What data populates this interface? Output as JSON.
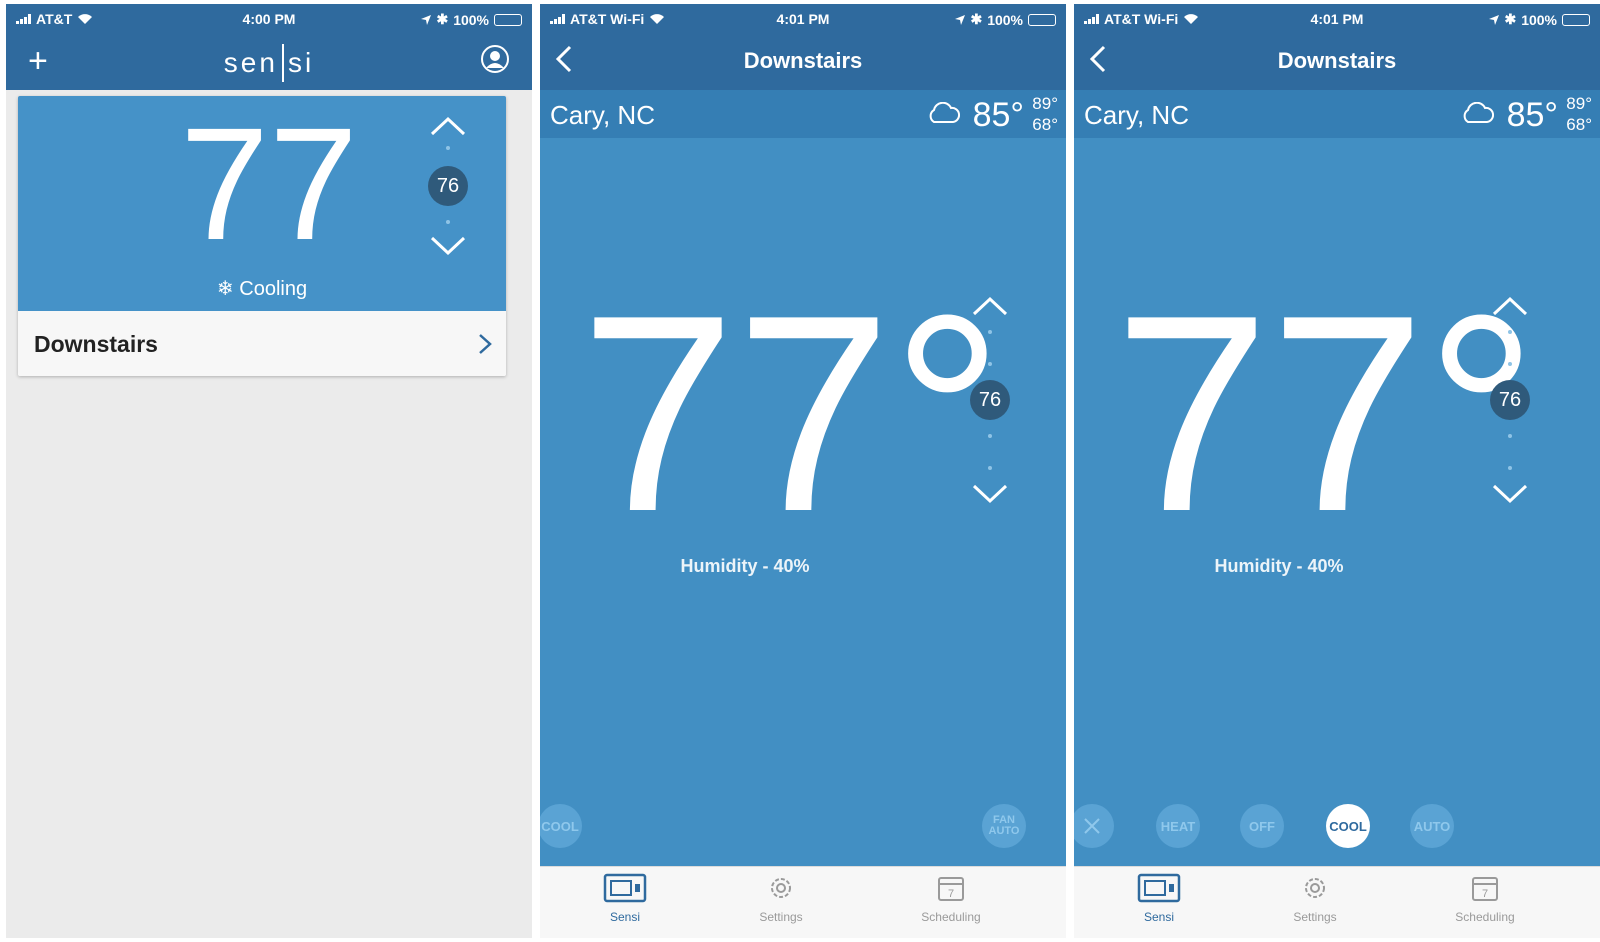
{
  "screens": [
    {
      "status": {
        "carrier": "AT&T",
        "time": "4:00 PM",
        "battery": "100%"
      },
      "header": {
        "logo_left": "sen",
        "logo_right": "si"
      },
      "card": {
        "current_temp": "77",
        "setpoint": "76",
        "mode_status": "Cooling",
        "thermostat_name": "Downstairs"
      }
    },
    {
      "status": {
        "carrier": "AT&T Wi-Fi",
        "time": "4:01 PM",
        "battery": "100%"
      },
      "header": {
        "title": "Downstairs"
      },
      "weather": {
        "city": "Cary, NC",
        "temp": "85°",
        "high": "89°",
        "low": "68°"
      },
      "current_temp": "77°",
      "setpoint": "76",
      "humidity": "Humidity - 40%",
      "mode_left": "COOL",
      "fan_line1": "FAN",
      "fan_line2": "AUTO",
      "tabs": [
        "Sensi",
        "Settings",
        "Scheduling"
      ],
      "calendar_day": "7"
    },
    {
      "status": {
        "carrier": "AT&T Wi-Fi",
        "time": "4:01 PM",
        "battery": "100%"
      },
      "header": {
        "title": "Downstairs"
      },
      "weather": {
        "city": "Cary, NC",
        "temp": "85°",
        "high": "89°",
        "low": "68°"
      },
      "current_temp": "77°",
      "setpoint": "76",
      "humidity": "Humidity - 40%",
      "modes": [
        "HEAT",
        "OFF",
        "COOL",
        "AUTO"
      ],
      "selected_mode": "COOL",
      "tabs": [
        "Sensi",
        "Settings",
        "Scheduling"
      ],
      "calendar_day": "7"
    }
  ],
  "colors": {
    "nav": "#2f6a9e",
    "weather_bar": "#357eb4",
    "main_bg": "#428fc3",
    "setpoint_badge": "#2f5a7b",
    "list_bg": "#ebebeb",
    "battery": "#4cd964"
  }
}
